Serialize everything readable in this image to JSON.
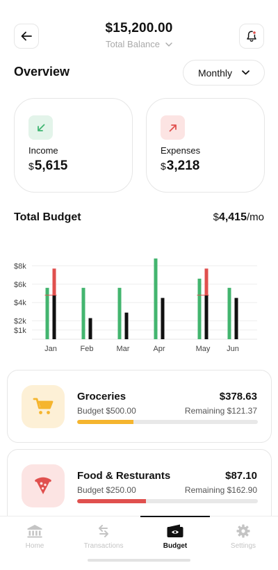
{
  "header": {
    "back_icon": "arrow-left-icon",
    "balance_amount": "$15,200.00",
    "balance_label": "Total Balance",
    "notification_icon": "bell-icon"
  },
  "overview": {
    "title": "Overview",
    "period": "Monthly"
  },
  "income": {
    "label": "Income",
    "currency": "$",
    "amount": "5,615",
    "accent": "#3fb572",
    "bg": "#e3f4ea"
  },
  "expenses": {
    "label": "Expenses",
    "currency": "$",
    "amount": "3,218",
    "accent": "#e0504e",
    "bg": "#fce4e3"
  },
  "budget": {
    "title": "Total Budget",
    "currency": "$",
    "amount": "4,415",
    "unit": "/mo"
  },
  "chart_data": {
    "type": "bar",
    "categories": [
      "Jan",
      "Feb",
      "Mar",
      "Apr",
      "May",
      "Jun"
    ],
    "y_ticks": [
      "$1k",
      "$2k",
      "$4k",
      "$6k",
      "$8k"
    ],
    "ylim": [
      0,
      10000
    ],
    "grid": true,
    "series": [
      {
        "color": "#43b56f",
        "values": [
          5600,
          5600,
          5600,
          8800,
          6600,
          5600
        ]
      },
      {
        "color": "#111111",
        "values": [
          4800,
          2300,
          2900,
          4500,
          4800,
          4500
        ]
      }
    ],
    "overspend": [
      {
        "category": "Jan",
        "from": 4800,
        "to": 7700,
        "color": "#e0504e"
      },
      {
        "category": "May",
        "from": 4800,
        "to": 7700,
        "color": "#e0504e"
      }
    ]
  },
  "categories": [
    {
      "name": "Groceries",
      "amount": "$378.63",
      "budget_text": "Budget $500.00",
      "remaining_text": "Remaining $121.37",
      "progress": 0.31,
      "icon": "shopping-cart-icon",
      "color": "#f5b52e",
      "bg": "#fdf0d6"
    },
    {
      "name": "Food & Resturants",
      "amount": "$87.10",
      "budget_text": "Budget $250.00",
      "remaining_text": "Remaining $162.90",
      "progress": 0.38,
      "icon": "pizza-icon",
      "color": "#e0504e",
      "bg": "#fce4e3"
    }
  ],
  "tabs": [
    {
      "label": "Home",
      "icon": "bank-icon",
      "active": false
    },
    {
      "label": "Transactions",
      "icon": "transfer-arrows-icon",
      "active": false
    },
    {
      "label": "Budget",
      "icon": "wallet-icon",
      "active": true
    },
    {
      "label": "Settings",
      "icon": "gear-icon",
      "active": false
    }
  ]
}
